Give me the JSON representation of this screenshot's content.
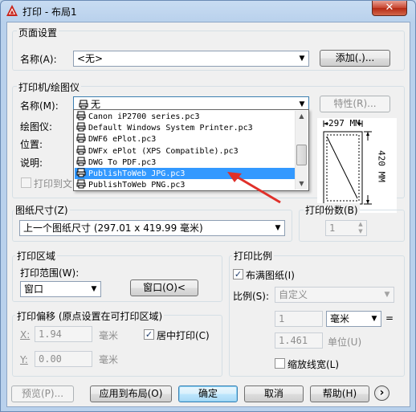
{
  "window": {
    "title": "打印 - 布局1",
    "close_glyph": "✕"
  },
  "page_setup": {
    "group_title": "页面设置",
    "name_label": "名称(A):",
    "name_value": "<无>",
    "add_button": "添加(.)..."
  },
  "printer": {
    "group_title": "打印机/绘图仪",
    "name_label": "名称(M):",
    "name_value": "无",
    "properties_button": "特性(R)...",
    "plotter_label": "绘图仪:",
    "location_label": "位置:",
    "description_label": "说明:",
    "print_to_file_label": "打印到文",
    "paper_width": "297 MM",
    "paper_height": "420 MM",
    "options": [
      "Canon iP2700 series.pc3",
      "Default Windows System Printer.pc3",
      "DWF6 ePlot.pc3",
      "DWFx ePlot (XPS Compatible).pc3",
      "DWG To PDF.pc3",
      "PublishToWeb JPG.pc3",
      "PublishToWeb PNG.pc3"
    ],
    "selected_index": 5
  },
  "paper_size": {
    "group_title": "图纸尺寸(Z)",
    "value": "上一个图纸尺寸 (297.01 x 419.99 毫米)"
  },
  "copies": {
    "group_title": "打印份数(B)",
    "value": "1"
  },
  "plot_area": {
    "group_title": "打印区域",
    "range_label": "打印范围(W):",
    "range_value": "窗口",
    "window_button": "窗口(O)<"
  },
  "plot_offset": {
    "group_title": "打印偏移 (原点设置在可打印区域)",
    "x_label": "X:",
    "x_value": "1.94",
    "x_unit": "毫米",
    "y_label": "Y:",
    "y_value": "0.00",
    "y_unit": "毫米",
    "center_label": "居中打印(C)",
    "center_checked": true
  },
  "plot_scale": {
    "group_title": "打印比例",
    "fit_label": "布满图纸(I)",
    "fit_checked": true,
    "scale_label": "比例(S):",
    "scale_value": "自定义",
    "value1": "1",
    "unit_value": "毫米",
    "equals": "=",
    "value2": "1.461",
    "unit_label": "单位(U)",
    "lineweight_label": "缩放线宽(L)"
  },
  "footer": {
    "preview": "预览(P)...",
    "apply": "应用到布局(O)",
    "ok": "确定",
    "cancel": "取消",
    "help": "帮助(H)",
    "more_glyph": "›"
  },
  "colors": {
    "selection": "#3399ff",
    "arrow": "#e0302a"
  }
}
